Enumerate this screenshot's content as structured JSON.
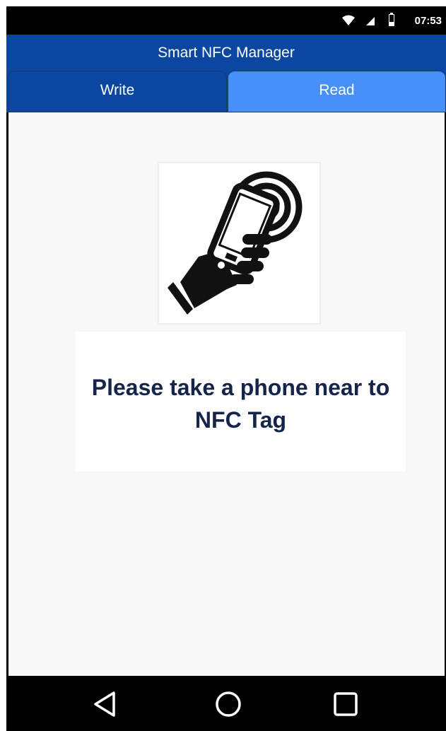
{
  "status_bar": {
    "time": "07:53",
    "icons": [
      "wifi-icon",
      "signal-icon",
      "battery-icon"
    ]
  },
  "app_bar": {
    "title": "Smart NFC Manager"
  },
  "tabs": [
    {
      "label": "Write",
      "selected": false
    },
    {
      "label": "Read",
      "selected": true
    }
  ],
  "main": {
    "illustration_icon": "nfc-phone-hand-icon",
    "message": "Please take a phone near to NFC Tag"
  },
  "nav_bar": {
    "buttons": [
      "back-icon",
      "home-icon",
      "recents-icon"
    ]
  },
  "colors": {
    "app_bar": "#0b47a1",
    "tab_selected": "#4690f7",
    "message_text": "#15254a"
  }
}
